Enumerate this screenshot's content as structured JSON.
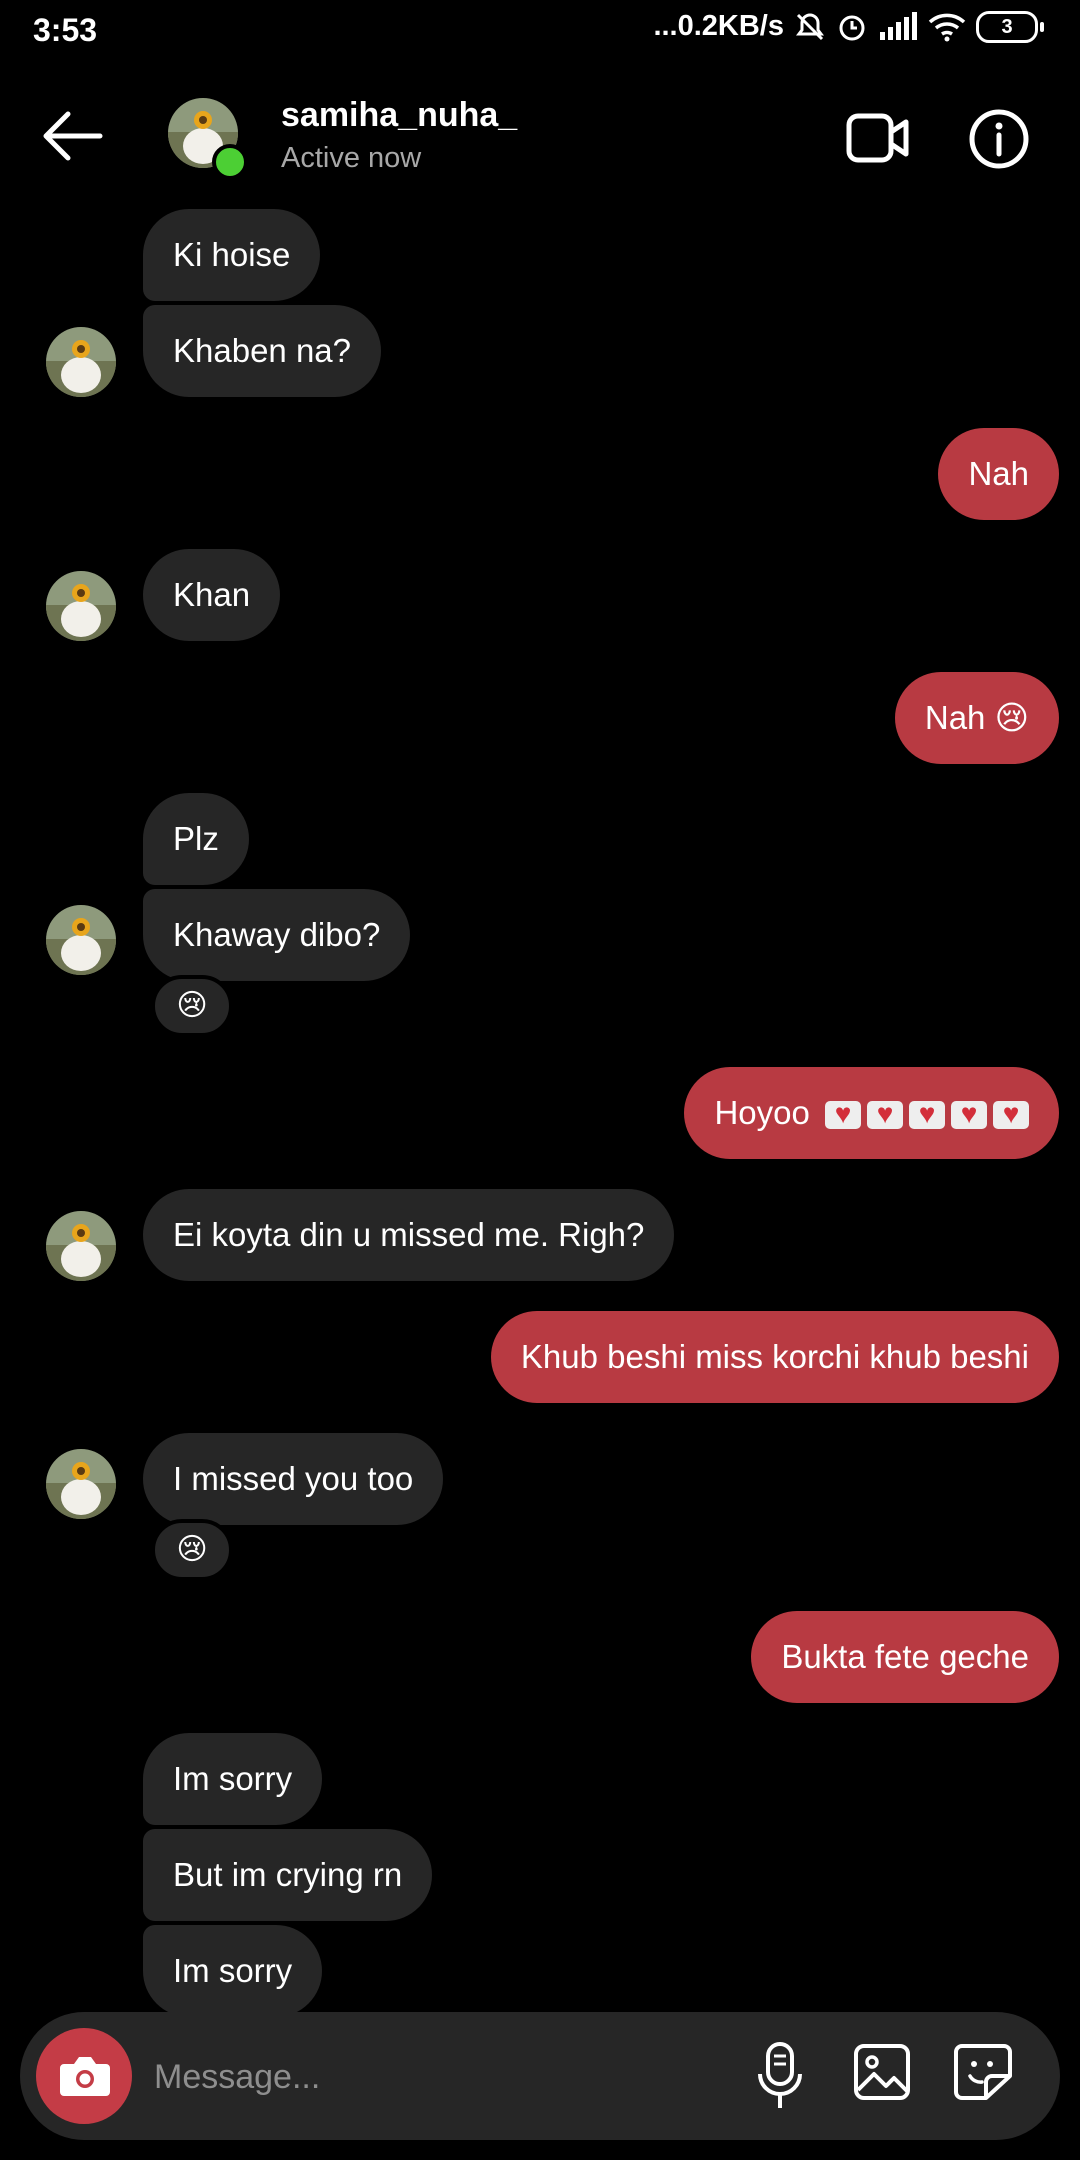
{
  "status_bar": {
    "time": "3:53",
    "network_speed": "...0.2KB/s",
    "battery": "3",
    "icons": [
      "mute-icon",
      "alarm-icon",
      "signal-icon",
      "wifi-icon",
      "battery-icon"
    ]
  },
  "header": {
    "username": "samiha_nuha_",
    "status": "Active now",
    "icons": [
      "back-arrow-icon",
      "video-call-icon",
      "info-icon"
    ],
    "online_color": "#4ccf34"
  },
  "messages": [
    {
      "from": "them",
      "text": "Ki hoise"
    },
    {
      "from": "them",
      "text": "Khaben na?"
    },
    {
      "from": "me",
      "text": "Nah"
    },
    {
      "from": "them",
      "text": "Khan"
    },
    {
      "from": "me",
      "text": "Nah",
      "emoji": "😢"
    },
    {
      "from": "them",
      "text": "Plz"
    },
    {
      "from": "them",
      "text": "Khaway dibo?",
      "reaction": "😢"
    },
    {
      "from": "me",
      "text": "Hoyoo",
      "emoji_count": 5,
      "emoji_name": "love-letter"
    },
    {
      "from": "them",
      "text": "Ei koyta din u missed me. Righ?"
    },
    {
      "from": "me",
      "text": "Khub beshi miss korchi khub beshi"
    },
    {
      "from": "them",
      "text": "I missed you too",
      "reaction": "😢"
    },
    {
      "from": "me",
      "text": "Bukta fete geche"
    },
    {
      "from": "them",
      "text": "Im sorry"
    },
    {
      "from": "them",
      "text": "But im crying rn"
    },
    {
      "from": "them",
      "text": "Im sorry"
    }
  ],
  "composer": {
    "placeholder": "Message...",
    "icons": [
      "camera-icon",
      "microphone-icon",
      "gallery-icon",
      "sticker-icon"
    ]
  },
  "colors": {
    "incoming_bubble": "#262626",
    "outgoing_bubble": "#b83a42",
    "camera_button": "#c43c46"
  }
}
